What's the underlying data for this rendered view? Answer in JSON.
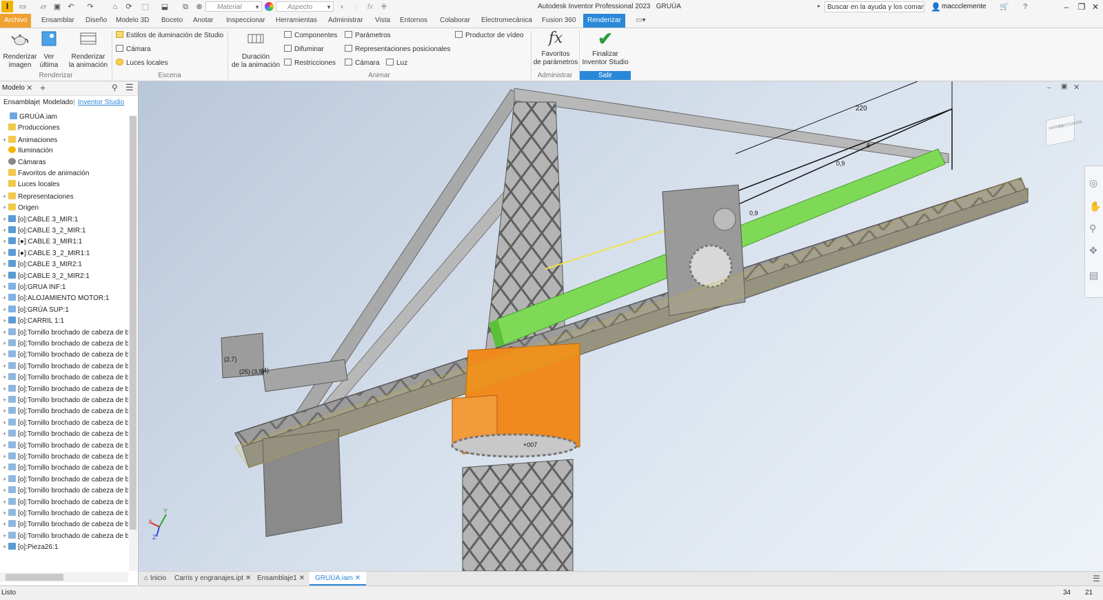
{
  "titlebar": {
    "app_title": "Autodesk Inventor Professional 2023",
    "document_name": "GRUÚA",
    "material_placeholder": "Material",
    "appearance_placeholder": "Aspecto",
    "help_search": "Buscar en la ayuda y los comanc",
    "user": "maccclemente"
  },
  "menu": {
    "tabs": [
      "Archivo",
      "Ensamblar",
      "Diseño",
      "Modelo 3D",
      "Boceto",
      "Anotar",
      "Inspeccionar",
      "Herramientas",
      "Administrar",
      "Vista",
      "Entornos",
      "Colaborar",
      "Electromecánica",
      "Fusion 360",
      "Renderizar"
    ]
  },
  "ribbon": {
    "renderizar": {
      "b1": "Renderizar",
      "b1b": "imagen",
      "b2": "Ver",
      "b2b": "última",
      "b3": "Renderizar",
      "b3b": "la animación",
      "group": "Renderizar"
    },
    "escena": {
      "s1": "Estilos de iluminación de Studio",
      "s2": "Cámara",
      "s3": "Luces locales",
      "group": "Escena"
    },
    "animar": {
      "b1": "Duración",
      "b1b": "de la animación",
      "s1": "Componentes",
      "s2": "Difuminar",
      "s3": "Restricciones",
      "s4": "Parámetros",
      "s5": "Representaciones posicionales",
      "s6": "Cámara",
      "s7": "Luz",
      "s8": "Productor de vídeo",
      "group": "Animar"
    },
    "administrar": {
      "b1": "Favoritos",
      "b1b": "de parámetros",
      "group": "Administrar"
    },
    "salir": {
      "b1": "Finalizar",
      "b1b": "Inventor Studio",
      "group": "Salir"
    }
  },
  "panel": {
    "title": "Modelo",
    "tabs": [
      "Ensamblaje",
      "Modelado",
      "Inventor Studio"
    ],
    "tree": [
      {
        "label": "GRUÚA.iam",
        "level": 0,
        "icon": "assembly"
      },
      {
        "label": "Producciones",
        "level": 1,
        "icon": "folder"
      },
      {
        "label": "Animaciones",
        "level": 1,
        "icon": "folder",
        "expand": true
      },
      {
        "label": "Iluminación",
        "level": 1,
        "icon": "sun"
      },
      {
        "label": "Cámaras",
        "level": 1,
        "icon": "camera"
      },
      {
        "label": "Favoritos de animación",
        "level": 1,
        "icon": "folder"
      },
      {
        "label": "Luces locales",
        "level": 1,
        "icon": "folder"
      },
      {
        "label": "Representaciones",
        "level": 1,
        "icon": "folder",
        "expand": true
      },
      {
        "label": "Origen",
        "level": 1,
        "icon": "folder",
        "expand": true
      },
      {
        "label": "[o]:CABLE 3_MIR:1",
        "level": 1,
        "icon": "part",
        "expand": true
      },
      {
        "label": "[o]:CABLE 3_2_MIR:1",
        "level": 1,
        "icon": "part",
        "expand": true
      },
      {
        "label": "[●]:CABLE 3_MIR1:1",
        "level": 1,
        "icon": "part",
        "expand": true
      },
      {
        "label": "[●]:CABLE 3_2_MIR1:1",
        "level": 1,
        "icon": "part",
        "expand": true
      },
      {
        "label": "[o]:CABLE 3_MIR2:1",
        "level": 1,
        "icon": "part",
        "expand": true
      },
      {
        "label": "[o]:CABLE 3_2_MIR2:1",
        "level": 1,
        "icon": "part",
        "expand": true
      },
      {
        "label": "[o]:GRUA INF:1",
        "level": 1,
        "icon": "sub",
        "expand": true
      },
      {
        "label": "[o]:ALOJAMIENTO MOTOR:1",
        "level": 1,
        "icon": "sub",
        "expand": true
      },
      {
        "label": "[o]:GRÚA SUP:1",
        "level": 1,
        "icon": "sub",
        "expand": true
      },
      {
        "label": "[o]:CARRIL 1:1",
        "level": 1,
        "icon": "part",
        "expand": true
      },
      {
        "label": "[o]:Tornillo brochado de cabeza de bot",
        "level": 1,
        "icon": "screw",
        "expand": true
      },
      {
        "label": "[o]:Tornillo brochado de cabeza de bot",
        "level": 1,
        "icon": "screw",
        "expand": true
      },
      {
        "label": "[o]:Tornillo brochado de cabeza de bot",
        "level": 1,
        "icon": "screw",
        "expand": true
      },
      {
        "label": "[o]:Tornillo brochado de cabeza de bot",
        "level": 1,
        "icon": "screw",
        "expand": true
      },
      {
        "label": "[o]:Tornillo brochado de cabeza de bot",
        "level": 1,
        "icon": "screw",
        "expand": true
      },
      {
        "label": "[o]:Tornillo brochado de cabeza de bot",
        "level": 1,
        "icon": "screw",
        "expand": true
      },
      {
        "label": "[o]:Tornillo brochado de cabeza de bot",
        "level": 1,
        "icon": "screw",
        "expand": true
      },
      {
        "label": "[o]:Tornillo brochado de cabeza de bot",
        "level": 1,
        "icon": "screw",
        "expand": true
      },
      {
        "label": "[o]:Tornillo brochado de cabeza de bot",
        "level": 1,
        "icon": "screw",
        "expand": true
      },
      {
        "label": "[o]:Tornillo brochado de cabeza de bot",
        "level": 1,
        "icon": "screw",
        "expand": true
      },
      {
        "label": "[o]:Tornillo brochado de cabeza de bot",
        "level": 1,
        "icon": "screw",
        "expand": true
      },
      {
        "label": "[o]:Tornillo brochado de cabeza de bot",
        "level": 1,
        "icon": "screw",
        "expand": true
      },
      {
        "label": "[o]:Tornillo brochado de cabeza de bot",
        "level": 1,
        "icon": "screw",
        "expand": true
      },
      {
        "label": "[o]:Tornillo brochado de cabeza de bot",
        "level": 1,
        "icon": "screw",
        "expand": true
      },
      {
        "label": "[o]:Tornillo brochado de cabeza de bot",
        "level": 1,
        "icon": "screw",
        "expand": true
      },
      {
        "label": "[o]:Tornillo brochado de cabeza de bot",
        "level": 1,
        "icon": "screw",
        "expand": true
      },
      {
        "label": "[o]:Tornillo brochado de cabeza de bot",
        "level": 1,
        "icon": "screw",
        "expand": true
      },
      {
        "label": "[o]:Tornillo brochado de cabeza de bot",
        "level": 1,
        "icon": "screw",
        "expand": true
      },
      {
        "label": "[o]:Tornillo brochado de cabeza de bot",
        "level": 1,
        "icon": "screw",
        "expand": true
      },
      {
        "label": "[o]:Pieza26:1",
        "level": 1,
        "icon": "part",
        "expand": true
      }
    ]
  },
  "viewport": {
    "dim_220": "220",
    "dim_8": "8",
    "dim_09a": "0,9",
    "dim_09b": "0,9",
    "dim_27": "(2,7)",
    "dim_25": "(25)",
    "dim_35": "(3,5)",
    "dim_4": "(4)",
    "dim_007": "+007",
    "viewcube_top": "ARRIBA",
    "viewcube_front": "POSTERIOR"
  },
  "doctabs": [
    "Inicio",
    "Carris y engranajes.ipt",
    "Ensamblaje1",
    "GRUÚA.iam"
  ],
  "status": {
    "text": "Listo",
    "n1": "34",
    "n2": "21"
  },
  "colors": {
    "accent": "#2a88d8",
    "file_tab": "#f0a030",
    "rail_green": "#7ed957",
    "selection_orange": "#f08a1e"
  }
}
